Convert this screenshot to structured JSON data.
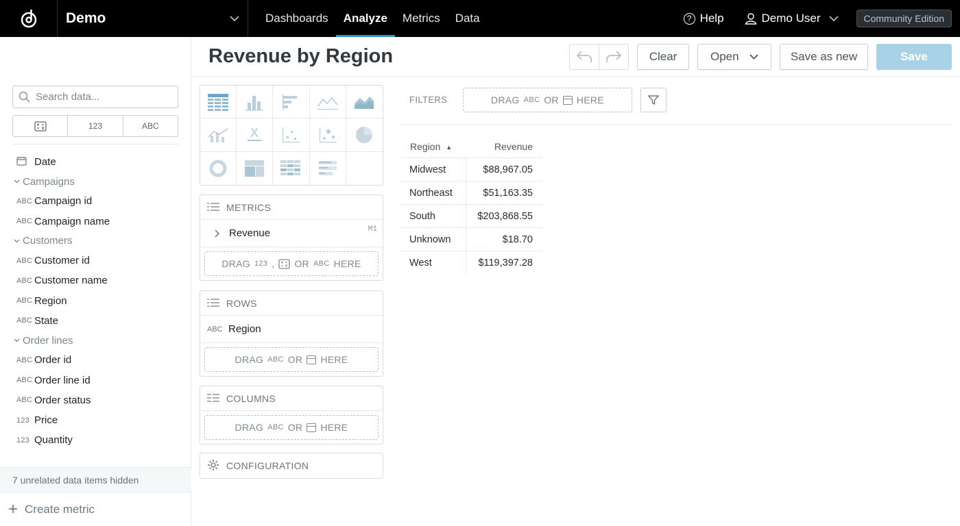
{
  "topbar": {
    "workspace": "Demo",
    "nav": [
      "Dashboards",
      "Analyze",
      "Metrics",
      "Data"
    ],
    "active_nav": "Analyze",
    "help": "Help",
    "user": "Demo User",
    "edition": "Community Edition"
  },
  "left": {
    "search_placeholder": "Search data...",
    "type_filters": [
      "123",
      "ABC"
    ],
    "items": [
      {
        "kind": "date",
        "label": "Date"
      },
      {
        "kind": "group",
        "label": "Campaigns"
      },
      {
        "kind": "attr",
        "type": "ABC",
        "label": "Campaign id"
      },
      {
        "kind": "attr",
        "type": "ABC",
        "label": "Campaign name"
      },
      {
        "kind": "group",
        "label": "Customers"
      },
      {
        "kind": "attr",
        "type": "ABC",
        "label": "Customer id"
      },
      {
        "kind": "attr",
        "type": "ABC",
        "label": "Customer name"
      },
      {
        "kind": "attr",
        "type": "ABC",
        "label": "Region"
      },
      {
        "kind": "attr",
        "type": "ABC",
        "label": "State"
      },
      {
        "kind": "group",
        "label": "Order lines"
      },
      {
        "kind": "attr",
        "type": "ABC",
        "label": "Order id"
      },
      {
        "kind": "attr",
        "type": "ABC",
        "label": "Order line id"
      },
      {
        "kind": "attr",
        "type": "ABC",
        "label": "Order status"
      },
      {
        "kind": "fact",
        "type": "123",
        "label": "Price"
      },
      {
        "kind": "fact",
        "type": "123",
        "label": "Quantity"
      }
    ],
    "hidden_note": "7 unrelated data items hidden",
    "create_metric": "Create metric"
  },
  "title": "Revenue by Region",
  "actions": {
    "clear": "Clear",
    "open": "Open",
    "save_as_new": "Save as new",
    "save": "Save"
  },
  "buckets": {
    "metrics_label": "METRICS",
    "metric_item": "Revenue",
    "metric_tag": "M1",
    "rows_label": "ROWS",
    "row_item_type": "ABC",
    "row_item": "Region",
    "columns_label": "COLUMNS",
    "configuration_label": "CONFIGURATION",
    "drag": "DRAG",
    "or": "OR",
    "here": "HERE",
    "num": "123",
    "abc": "ABC",
    "comma": ","
  },
  "filters": {
    "label": "FILTERS"
  },
  "table": {
    "headers": [
      "Region",
      "Revenue"
    ],
    "rows": [
      [
        "Midwest",
        "$88,967.05"
      ],
      [
        "Northeast",
        "$51,163.35"
      ],
      [
        "South",
        "$203,868.55"
      ],
      [
        "Unknown",
        "$18.70"
      ],
      [
        "West",
        "$119,397.28"
      ]
    ]
  },
  "colors": {
    "accent": "#2e97c9",
    "save_disabled": "#a9d2e6"
  }
}
